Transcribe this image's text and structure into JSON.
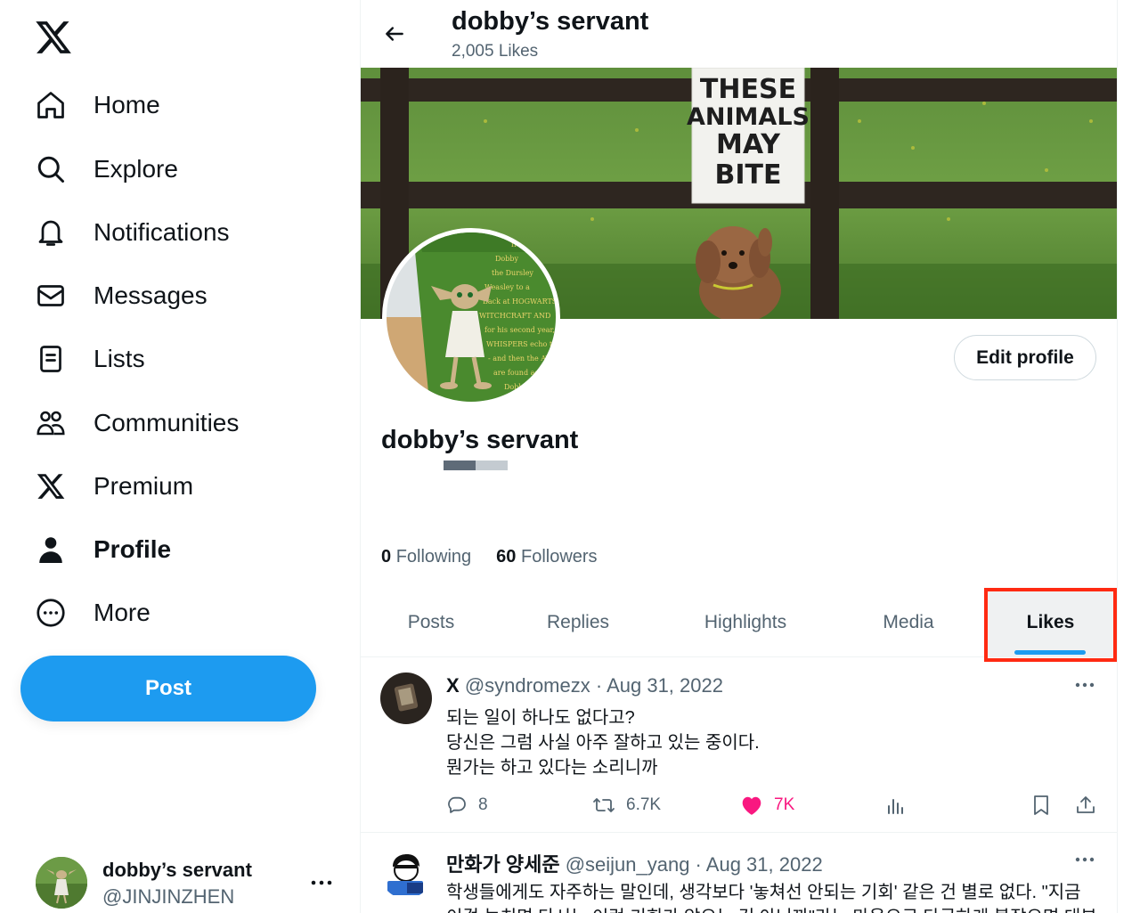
{
  "sidebar": {
    "logo_icon": "x-logo-icon",
    "items": [
      {
        "label": "Home",
        "icon": "home-icon"
      },
      {
        "label": "Explore",
        "icon": "search-icon"
      },
      {
        "label": "Notifications",
        "icon": "bell-icon"
      },
      {
        "label": "Messages",
        "icon": "envelope-icon"
      },
      {
        "label": "Lists",
        "icon": "list-icon"
      },
      {
        "label": "Communities",
        "icon": "people-icon"
      },
      {
        "label": "Premium",
        "icon": "x-logo-icon"
      },
      {
        "label": "Profile",
        "icon": "person-icon",
        "active": true
      },
      {
        "label": "More",
        "icon": "more-circle-icon"
      }
    ],
    "post_label": "Post",
    "account": {
      "name": "dobby’s servant",
      "handle": "@JINJINZHEN"
    }
  },
  "header": {
    "title": "dobby’s servant",
    "subtitle": "2,005 Likes"
  },
  "banner": {
    "sign_lines": [
      "THESE",
      "ANIMALS",
      "MAY",
      "BITE"
    ]
  },
  "profile": {
    "name": "dobby’s servant",
    "edit_label": "Edit profile",
    "following_count": "0",
    "following_label": "Following",
    "followers_count": "60",
    "followers_label": "Followers"
  },
  "tabs": [
    {
      "label": "Posts"
    },
    {
      "label": "Replies"
    },
    {
      "label": "Highlights"
    },
    {
      "label": "Media"
    },
    {
      "label": "Likes",
      "active": true
    }
  ],
  "colors": {
    "accent": "#1d9bf0",
    "like": "#f91880",
    "annotation": "#ff2a12"
  },
  "tweets": [
    {
      "author": "X",
      "handle_date": "@syndromezx · Aug 31, 2022",
      "lines": [
        "되는 일이 하나도 없다고?",
        "당신은 그럼 사실 아주 잘하고 있는 중이다.",
        "뭔가는 하고 있다는 소리니까"
      ],
      "replies": "8",
      "reposts": "6.7K",
      "likes": "7K"
    },
    {
      "author": "만화가 양세준",
      "handle_date": "@seijun_yang · Aug 31, 2022",
      "lines": [
        "학생들에게도 자주하는 말인데, 생각보다 '놓쳐선 안되는 기회' 같은 건 별로 없다. \"지금",
        "이걸 놓치면 다시는 이런 기회가 않으는 건 아닌까\"라는 마음으로 다급하게 붙잡으면 대부"
      ]
    }
  ]
}
